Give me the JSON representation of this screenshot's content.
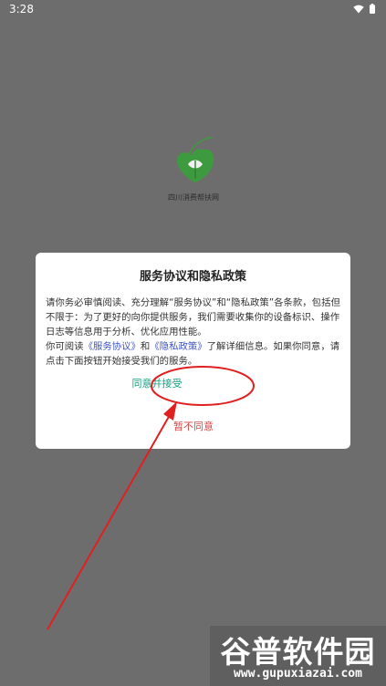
{
  "status_bar": {
    "time": "3:28",
    "icons": [
      "wifi-icon",
      "battery-icon"
    ]
  },
  "splash": {
    "app_name": "四川消费帮扶网",
    "logo": "leaf-logo"
  },
  "dialog": {
    "title": "服务协议和隐私政策",
    "body_part1": "请你务必审慎阅读、充分理解“服务协议”和“隐私政策”各条款，包括但不限于：为了更好的向你提供服务，我们需要收集你的设备标识、操作日志等信息用于分析、优化应用性能。",
    "body_part2_prefix": "你可阅读",
    "service_link": "《服务协议》",
    "body_and": "和",
    "privacy_link": "《隐私政策》",
    "body_part2_suffix": "了解详细信息。如果你同意，请点击下面按钮开始接受我们的服务。",
    "agree_label": "同意并接受",
    "disagree_label": "暂不同意"
  },
  "watermark": {
    "brand": "谷普软件园",
    "url": "www.gupuxiazai.com"
  },
  "colors": {
    "dim": "#6d6d6d",
    "agree": "#16a085",
    "disagree": "#d64545",
    "link": "#3d54c8",
    "annotation": "#e02020"
  }
}
